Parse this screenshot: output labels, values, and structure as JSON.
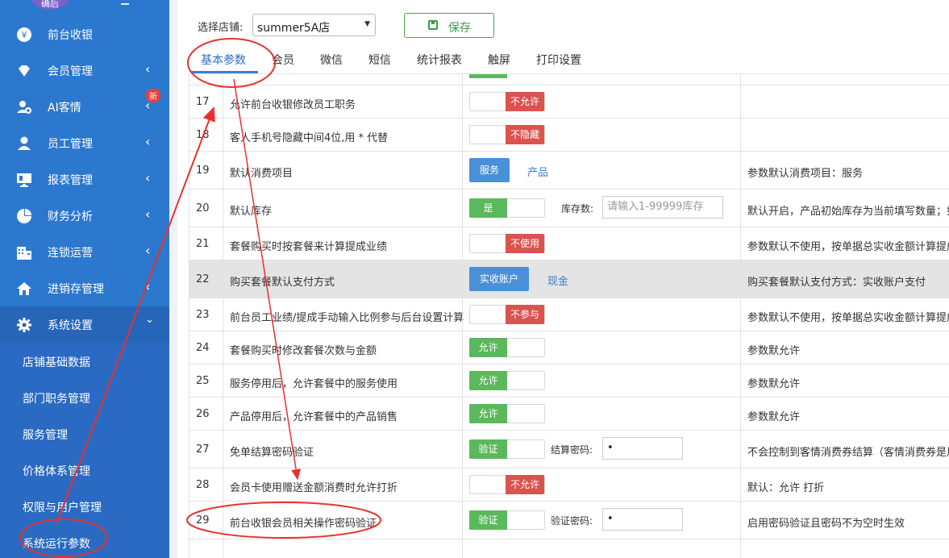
{
  "sidebar": {
    "logo_label": "确后",
    "items": [
      {
        "label": "前台收银",
        "icon": "yen-icon"
      },
      {
        "label": "会员管理",
        "icon": "diamond-icon"
      },
      {
        "label": "AI客情",
        "icon": "user-plus-icon"
      },
      {
        "label": "员工管理",
        "icon": "user-icon"
      },
      {
        "label": "报表管理",
        "icon": "monitor-icon"
      },
      {
        "label": "财务分析",
        "icon": "pie-icon"
      },
      {
        "label": "连锁运营",
        "icon": "building-icon"
      },
      {
        "label": "进销存管理",
        "icon": "home-icon"
      },
      {
        "label": "系统设置",
        "icon": "gear-icon"
      }
    ],
    "badge": "新",
    "sub_items": [
      "店铺基础数据",
      "部门职务管理",
      "服务管理",
      "价格体系管理",
      "权限与用户管理",
      "系统运行参数"
    ]
  },
  "topbar": {
    "store_label": "选择店铺:",
    "store_value": "summer5A店",
    "save_label": "保存"
  },
  "tabs": [
    "基本参数",
    "会员",
    "微信",
    "短信",
    "统计报表",
    "触屏",
    "打印设置"
  ],
  "rows": [
    {
      "no": "17",
      "name": "允许前台收银修改员工职务",
      "toggle": "不允许",
      "state": "off",
      "desc": ""
    },
    {
      "no": "18",
      "name": "客人手机号隐藏中间4位,用 * 代替",
      "toggle": "不隐藏",
      "state": "off",
      "desc": ""
    },
    {
      "no": "19",
      "name": "默认消费项目",
      "choice_on": "服务",
      "choice_off": "产品",
      "desc": "参数默认消费项目：服务"
    },
    {
      "no": "20",
      "name": "默认库存",
      "toggle": "是",
      "state": "on",
      "sub_label": "库存数:",
      "input_placeholder": "请输入1-99999库存",
      "desc": "默认开启，产品初始库存为当前填写数量；如果"
    },
    {
      "no": "21",
      "name": "套餐购买时按套餐来计算提成业绩",
      "toggle": "不使用",
      "state": "off",
      "desc": "参数默认不使用，按单据总实收金额计算提成业"
    },
    {
      "no": "22",
      "name": "购买套餐默认支付方式",
      "choice_on": "实收账户",
      "choice_off": "现金",
      "desc": "购买套餐默认支付方式：实收账户支付"
    },
    {
      "no": "23",
      "name": "前台员工业绩/提成手动输入比例参与后台设置计算",
      "toggle": "不参与",
      "state": "off",
      "desc": "参数默认不使用，按单据总实收金额计算提成业"
    },
    {
      "no": "24",
      "name": "套餐购买时修改套餐次数与金额",
      "toggle": "允许",
      "state": "on",
      "desc": "参数默允许"
    },
    {
      "no": "25",
      "name": "服务停用后，允许套餐中的服务使用",
      "toggle": "允许",
      "state": "on",
      "desc": "参数默允许"
    },
    {
      "no": "26",
      "name": "产品停用后，允许套餐中的产品销售",
      "toggle": "允许",
      "state": "on",
      "desc": "参数默允许"
    },
    {
      "no": "27",
      "name": "免单结算密码验证",
      "toggle": "验证",
      "state": "on",
      "sub_label": "结算密码:",
      "input_value": "•",
      "desc": "不会控制到客情消费券结算（客情消费券是用的"
    },
    {
      "no": "28",
      "name": "会员卡使用赠送金额消费时允许打折",
      "toggle": "不允许",
      "state": "off",
      "desc": "默认：允许 打折"
    },
    {
      "no": "29",
      "name": "前台收银会员相关操作密码验证",
      "toggle": "验证",
      "state": "on",
      "sub_label": "验证密码:",
      "input_value": "•",
      "desc": "启用密码验证且密码不为空时生效"
    }
  ],
  "colors": {
    "sidebar": "#2c78cf",
    "annotation": "#e8312f",
    "toggle_on": "#5cb85c",
    "toggle_off": "#d9534f",
    "chip": "#4a90d9"
  }
}
